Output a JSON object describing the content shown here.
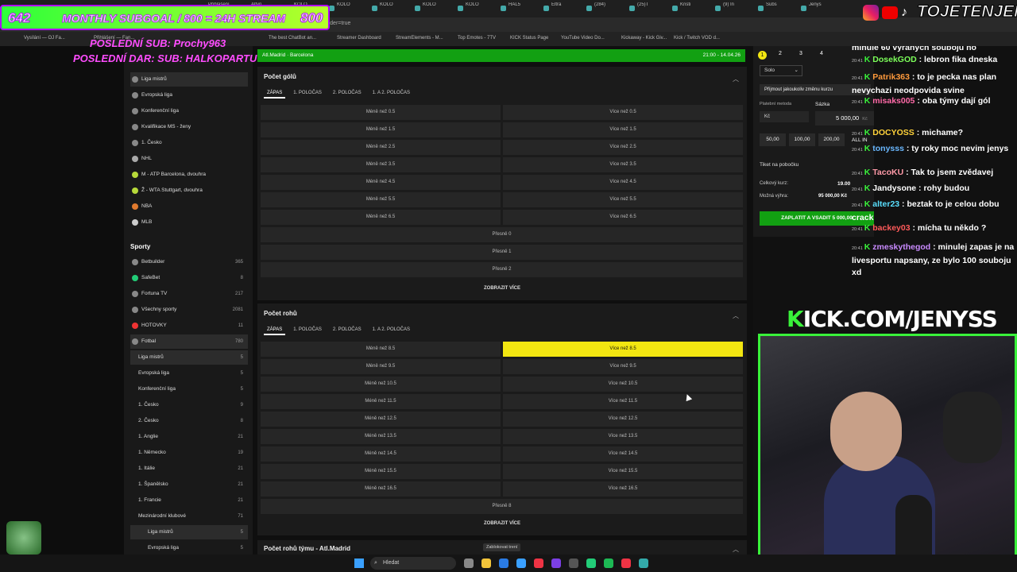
{
  "browser": {
    "tabs": [
      "Přihlášení",
      "Altyn",
      "KOLO",
      "KOLO",
      "KOLO",
      "KOLO",
      "KOLO",
      "HAL5",
      "Eltra",
      "(284)",
      "(25)T",
      "Kristi",
      "(9) In",
      "Subs",
      "Jenys"
    ],
    "url": "filter=all&tab=...nbetbuilder=true",
    "bookmarks": [
      "Vysílání — OJ Fa...",
      "Přihlášení — Fan...",
      "The best ChatBot an...",
      "Streamer Dashboard",
      "StreamElements - M...",
      "Top Emotes - 7TV",
      "KICK Status Page",
      "YouTube Video Do...",
      "Kickaway - Kick Giv...",
      "Kick / Twitch VOD d..."
    ]
  },
  "overlay": {
    "goal_count": "642",
    "goal_text": "MONTHLY SUBGOAL / 800 = 24H STREAM",
    "goal_target": "800",
    "last_sub": "POSLEDNÍ SUB: Prochy963",
    "last_donation": "POSLEDNÍ DAR: SUB: HALKOPARTU",
    "social_handle": "TOJETENJENYS",
    "kick_prefix": "K",
    "kick_text": "ICK.COM/JENYSS"
  },
  "sidebar": {
    "top_items": [
      {
        "label": "Liga mistrů",
        "icon": "trophy-icon"
      },
      {
        "label": "Evropská liga",
        "icon": "trophy-icon"
      },
      {
        "label": "Konferenční liga",
        "icon": "trophy-icon"
      },
      {
        "label": "Kvalifikace MS - ženy",
        "icon": "trophy-icon"
      },
      {
        "label": "1. Česko",
        "icon": "flag-icon"
      },
      {
        "label": "NHL",
        "icon": "hockey-icon"
      },
      {
        "label": "M - ATP Barcelona, dvouhra",
        "icon": "tennis-icon"
      },
      {
        "label": "Ž - WTA Stuttgart, dvouhra",
        "icon": "tennis-icon"
      },
      {
        "label": "NBA",
        "icon": "basketball-icon"
      },
      {
        "label": "MLB",
        "icon": "baseball-icon"
      }
    ],
    "sports_heading": "Sporty",
    "sports": [
      {
        "label": "Betbuilder",
        "count": "365"
      },
      {
        "label": "SafeBet",
        "count": "8"
      },
      {
        "label": "Fortuna TV",
        "count": "217"
      },
      {
        "label": "Všechny sporty",
        "count": "2081"
      },
      {
        "label": "HOTOVKY",
        "count": "11"
      },
      {
        "label": "Fotbal",
        "count": "780"
      }
    ],
    "football": [
      {
        "label": "Liga mistrů",
        "count": "5"
      },
      {
        "label": "Evropská liga",
        "count": "5"
      },
      {
        "label": "Konferenční liga",
        "count": "5"
      },
      {
        "label": "1. Česko",
        "count": "9"
      },
      {
        "label": "2. Česko",
        "count": "8"
      },
      {
        "label": "1. Anglie",
        "count": "21"
      },
      {
        "label": "1. Německo",
        "count": "19"
      },
      {
        "label": "1. Itálie",
        "count": "21"
      },
      {
        "label": "1. Španělsko",
        "count": "21"
      },
      {
        "label": "1. Francie",
        "count": "21"
      },
      {
        "label": "Mezinárodní klubové",
        "count": "71"
      },
      {
        "label": "Liga mistrů",
        "count": "5"
      },
      {
        "label": "Evropská liga",
        "count": "5"
      }
    ]
  },
  "match": {
    "teams": "Atl.Madrid · Barcelona",
    "time": "21:00 - 14.04.26"
  },
  "goals_panel": {
    "title": "Počet gólů",
    "tabs": [
      "ZÁPAS",
      "1. POLOČAS",
      "2. POLOČAS",
      "1. A 2. POLOČAS"
    ],
    "rows": [
      [
        "Méně než 0.5",
        "Více než 0.5"
      ],
      [
        "Méně než 1.5",
        "Více než 1.5"
      ],
      [
        "Méně než 2.5",
        "Více než 2.5"
      ],
      [
        "Méně než 3.5",
        "Více než 3.5"
      ],
      [
        "Méně než 4.5",
        "Více než 4.5"
      ],
      [
        "Méně než 5.5",
        "Více než 5.5"
      ],
      [
        "Méně než 6.5",
        "Více než 6.5"
      ]
    ],
    "exact": [
      "Přesně 0",
      "Přesně 1",
      "Přesně 2"
    ],
    "more": "ZOBRAZIT VÍCE"
  },
  "corners_panel": {
    "title": "Počet rohů",
    "tabs": [
      "ZÁPAS",
      "1. POLOČAS",
      "2. POLOČAS",
      "1. A 2. POLOČAS"
    ],
    "rows": [
      [
        "Méně než 8.5",
        "Více než 8.5"
      ],
      [
        "Méně než 9.5",
        "Více než 9.5"
      ],
      [
        "Méně než 10.5",
        "Více než 10.5"
      ],
      [
        "Méně než 11.5",
        "Více než 11.5"
      ],
      [
        "Méně než 12.5",
        "Více než 12.5"
      ],
      [
        "Méně než 13.5",
        "Více než 13.5"
      ],
      [
        "Méně než 14.5",
        "Více než 14.5"
      ],
      [
        "Méně než 15.5",
        "Více než 15.5"
      ],
      [
        "Méně než 16.5",
        "Více než 16.5"
      ]
    ],
    "exact": "Přesně 8",
    "more": "ZOBRAZIT VÍCE"
  },
  "team_corners_title": "Počet rohů týmu - Atl.Madrid",
  "pin_button": "Zablokovat trení",
  "betslip": {
    "tabs": [
      "1",
      "2",
      "3",
      "4"
    ],
    "mode": "Solo",
    "accept": "Přijmout jakoukoliv změnu kurzu",
    "payment_label": "Platební metoda",
    "stake_label": "Sázka",
    "payment_value": "Kč",
    "stake_value": "5 000,00",
    "stake_currency": "Kč",
    "quick": [
      "50,00",
      "100,00",
      "200,00"
    ],
    "all_in": "ALL IN",
    "ticket": "Tiket na pobočku",
    "total_odds_label": "Celkový kurz:",
    "total_odds": "19.00",
    "win_label": "Možná výhra:",
    "win_value": "95 000,00 Kč",
    "submit": "ZAPLATIT A VSADIT 5 000,00"
  },
  "chat": [
    {
      "ts": "",
      "user": "",
      "text": "minule 60 výraných souboju no",
      "color": "#ffffff"
    },
    {
      "ts": "20:41",
      "user": "DosekGOD",
      "text": " : lebron fika dneska",
      "color": "#7cff5a"
    },
    {
      "ts": "20:41",
      "user": "Patrik363",
      "text": " : to je pecka nas plan nevychazi neodpovida svine",
      "color": "#ff9a3c"
    },
    {
      "ts": "20:41",
      "user": "misaks005",
      "text": " : oba týmy dají gól",
      "color": "#ff6aa8"
    },
    {
      "ts": "20:41",
      "user": "DOCYOSS",
      "text": " : michame?",
      "color": "#ffd23a"
    },
    {
      "ts": "20:41",
      "user": "tonysss",
      "text": " : ty roky moc nevim jenys",
      "color": "#6ab8ff"
    },
    {
      "ts": "20:41",
      "user": "TacoKU",
      "text": " : Tak to jsem zvědavej",
      "color": "#ff9aa8"
    },
    {
      "ts": "20:41",
      "user": "Jandysone",
      "text": " : rohy budou",
      "color": "#ffffff"
    },
    {
      "ts": "20:41",
      "user": "alter23",
      "text": " : beztak to je celou dobu crack",
      "color": "#5ae0ff"
    },
    {
      "ts": "20:41",
      "user": "backey03",
      "text": " : mícha tu někdo ?",
      "color": "#ff5a5a"
    },
    {
      "ts": "20:41",
      "user": "zmeskythegod",
      "text": " : minulej zapas je na livesportu napsany, ze bylo 100 souboju xd",
      "color": "#c98bff"
    }
  ],
  "taskbar": {
    "search": "Hledat"
  },
  "colors": {
    "accent_green": "#12a012",
    "selected_odd": "#f2e611",
    "kick_green": "#39f23a"
  }
}
